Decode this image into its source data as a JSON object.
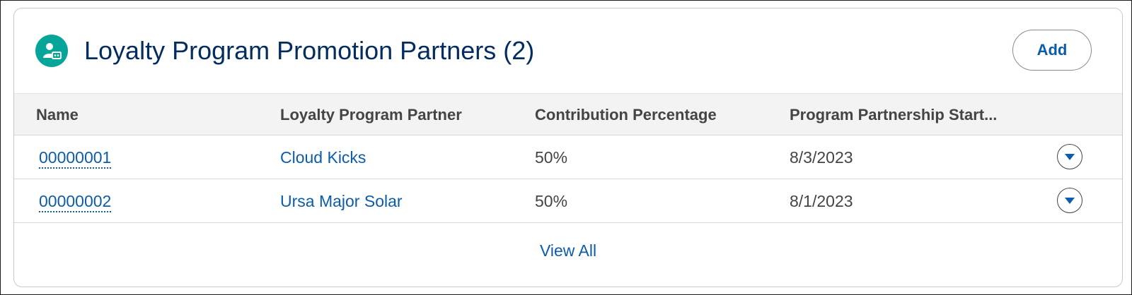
{
  "card": {
    "title": "Loyalty Program Promotion Partners (2)",
    "icon": "partner-icon",
    "add_label": "Add"
  },
  "table": {
    "columns": [
      "Name",
      "Loyalty Program Partner",
      "Contribution Percentage",
      "Program Partnership Start..."
    ],
    "rows": [
      {
        "name": "00000001",
        "partner": "Cloud Kicks",
        "contribution": "50%",
        "start": "8/3/2023"
      },
      {
        "name": "00000002",
        "partner": "Ursa Major Solar",
        "contribution": "50%",
        "start": "8/1/2023"
      }
    ]
  },
  "footer": {
    "view_all_label": "View All"
  },
  "colors": {
    "icon_background": "#06a59a",
    "title": "#032d60",
    "link": "#0b5cab"
  }
}
